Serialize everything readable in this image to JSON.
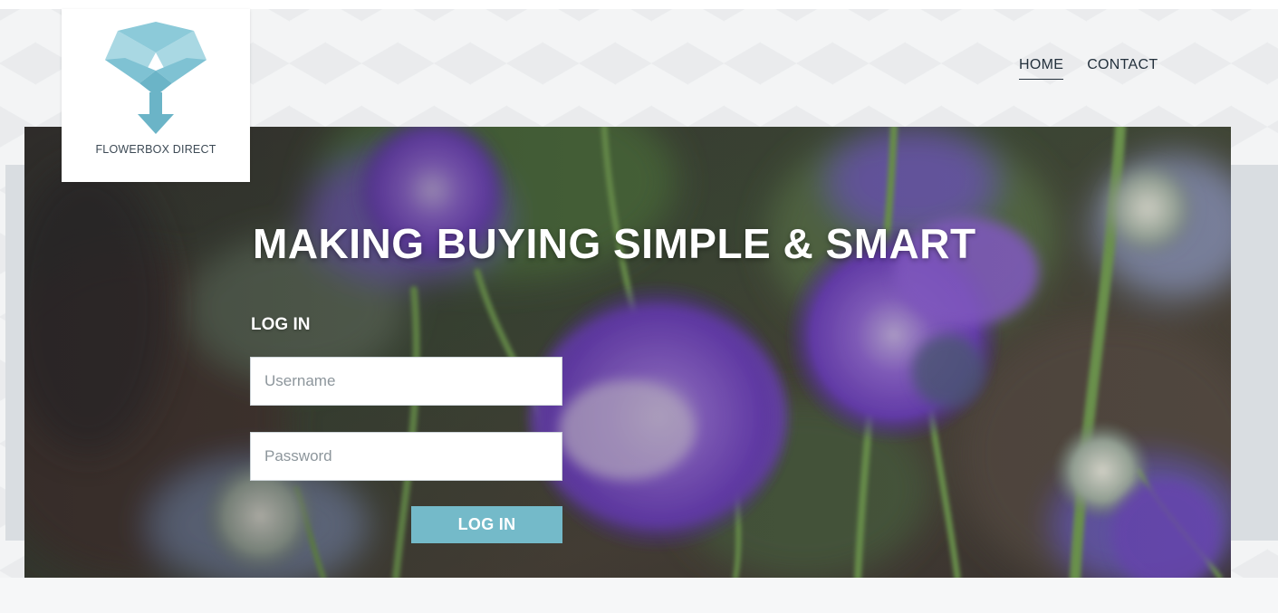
{
  "brand": {
    "name": "FLOWERBOX DIRECT",
    "logo_icon": "open-box-arrow-icon",
    "accent_color": "#74bac9"
  },
  "nav": {
    "items": [
      {
        "label": "HOME",
        "active": true
      },
      {
        "label": "CONTACT",
        "active": false
      }
    ]
  },
  "hero": {
    "headline": "MAKING BUYING SIMPLE & SMART",
    "background": "purple-scabiosa-flowers-photo"
  },
  "login": {
    "title": "LOG IN",
    "username_placeholder": "Username",
    "password_placeholder": "Password",
    "button_label": "LOG IN"
  }
}
